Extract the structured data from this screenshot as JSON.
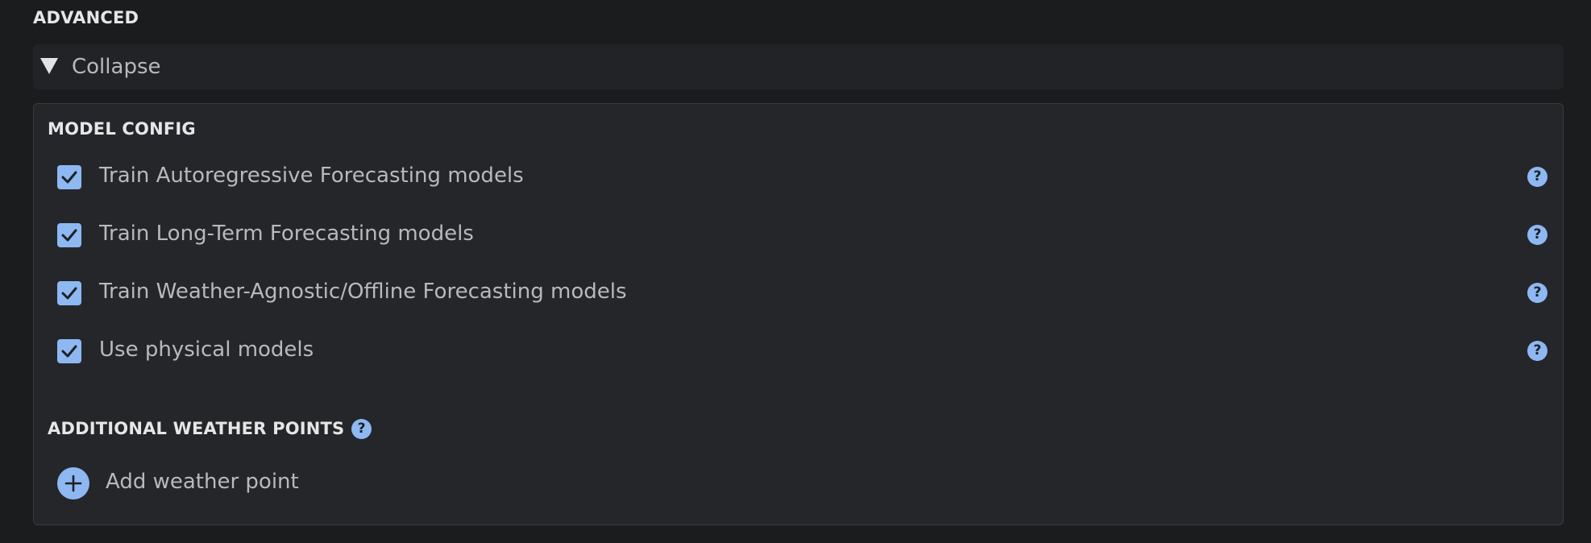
{
  "advanced": {
    "heading": "ADVANCED",
    "collapse_label": "Collapse"
  },
  "model_config": {
    "heading": "MODEL CONFIG",
    "options": [
      {
        "label": "Train Autoregressive Forecasting models",
        "checked": true
      },
      {
        "label": "Train Long-Term Forecasting models",
        "checked": true
      },
      {
        "label": "Train Weather-Agnostic/Offline Forecasting models",
        "checked": true
      },
      {
        "label": "Use physical models",
        "checked": true
      }
    ],
    "help_glyph": "?"
  },
  "weather_points": {
    "heading": "ADDITIONAL WEATHER POINTS",
    "help_glyph": "?",
    "add_label": "Add weather point"
  },
  "colors": {
    "accent": "#8db8f2",
    "background": "#1b1c1e",
    "panel": "#25262a",
    "text": "#b9b9bb",
    "heading": "#e6e6e6"
  },
  "icons": {
    "collapse": "triangle-down-icon",
    "checkbox": "checkmark-icon",
    "help": "question-circle-icon",
    "add": "plus-circle-icon"
  }
}
